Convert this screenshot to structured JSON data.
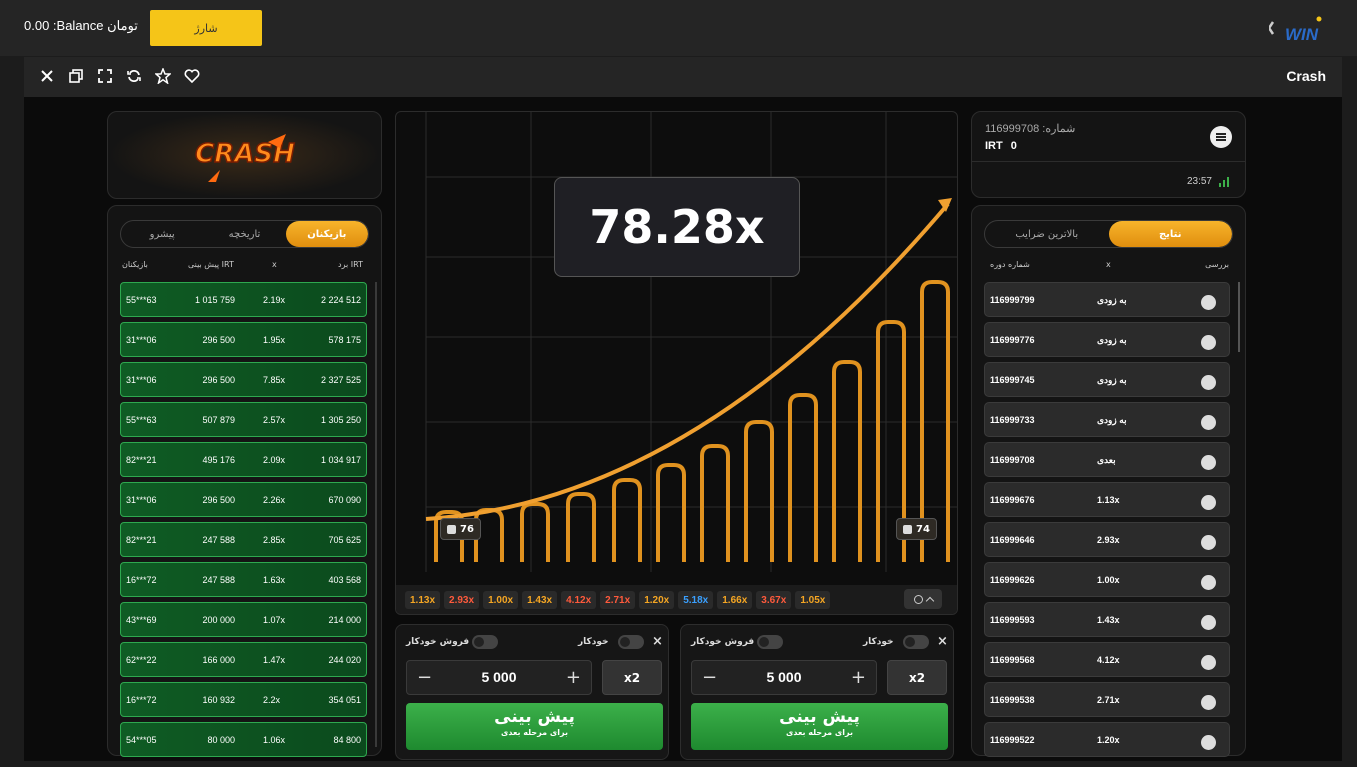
{
  "topbar": {
    "balance": "0.00 :Balance تومان",
    "charge_label": "شارژ",
    "logo_text": "WIN"
  },
  "frame": {
    "title": "Crash"
  },
  "logo_panel": {
    "text": "CRASH"
  },
  "players": {
    "tabs": [
      "پیشرو",
      "تاریخچه",
      "بازیکنان"
    ],
    "active_tab": 2,
    "headers": {
      "win": "برد IRT",
      "x": "x",
      "bet": "پیش بینی IRT",
      "player": "بازیکنان"
    },
    "rows": [
      {
        "player": "55***63",
        "bet": "1 015 759",
        "x": "2.19x",
        "win": "2 224 512"
      },
      {
        "player": "31***06",
        "bet": "296 500",
        "x": "1.95x",
        "win": "578 175"
      },
      {
        "player": "31***06",
        "bet": "296 500",
        "x": "7.85x",
        "win": "2 327 525"
      },
      {
        "player": "55***63",
        "bet": "507 879",
        "x": "2.57x",
        "win": "1 305 250"
      },
      {
        "player": "82***21",
        "bet": "495 176",
        "x": "2.09x",
        "win": "1 034 917"
      },
      {
        "player": "31***06",
        "bet": "296 500",
        "x": "2.26x",
        "win": "670 090"
      },
      {
        "player": "82***21",
        "bet": "247 588",
        "x": "2.85x",
        "win": "705 625"
      },
      {
        "player": "16***72",
        "bet": "247 588",
        "x": "1.63x",
        "win": "403 568"
      },
      {
        "player": "43***69",
        "bet": "200 000",
        "x": "1.07x",
        "win": "214 000"
      },
      {
        "player": "62***22",
        "bet": "166 000",
        "x": "1.47x",
        "win": "244 020"
      },
      {
        "player": "16***72",
        "bet": "160 932",
        "x": "2.2x",
        "win": "354 051"
      },
      {
        "player": "54***05",
        "bet": "80 000",
        "x": "1.06x",
        "win": "84 800"
      }
    ]
  },
  "game": {
    "multiplier": "78.28x",
    "left_badge": "76",
    "right_badge": "74",
    "history": [
      {
        "v": "1.13x",
        "c": "#f5a623"
      },
      {
        "v": "2.93x",
        "c": "#ff5a3c"
      },
      {
        "v": "1.00x",
        "c": "#f5a623"
      },
      {
        "v": "1.43x",
        "c": "#f5a623"
      },
      {
        "v": "4.12x",
        "c": "#ff5a3c"
      },
      {
        "v": "2.71x",
        "c": "#ff5a3c"
      },
      {
        "v": "1.20x",
        "c": "#f5a623"
      },
      {
        "v": "5.18x",
        "c": "#3aa0ff"
      },
      {
        "v": "1.66x",
        "c": "#f5a623"
      },
      {
        "v": "3.67x",
        "c": "#ff5a3c"
      },
      {
        "v": "1.05x",
        "c": "#f5a623"
      }
    ]
  },
  "bet_panels": [
    {
      "close": "×",
      "auto_label": "خودکار",
      "autosell_label": "فروش خودکار",
      "minus": "−",
      "amount": "5 000",
      "plus": "+",
      "double": "x2",
      "btn_title": "پیش بینی",
      "btn_sub": "برای مرحله بعدی"
    },
    {
      "close": "×",
      "auto_label": "خودکار",
      "autosell_label": "فروش خودکار",
      "minus": "−",
      "amount": "5 000",
      "plus": "+",
      "double": "x2",
      "btn_title": "پیش بینی",
      "btn_sub": "برای مرحله بعدی"
    }
  ],
  "round_info": {
    "round_number": "116999708 :شماره",
    "currency": "IRT",
    "balance": "0",
    "time": "23:57"
  },
  "results": {
    "tabs": [
      "بالاترین ضرایب",
      "نتایج"
    ],
    "active_tab": 1,
    "headers": {
      "check": "بررسی",
      "x": "x",
      "round": "شماره دوره"
    },
    "rows": [
      {
        "round": "116999799",
        "x": "به زودی"
      },
      {
        "round": "116999776",
        "x": "به زودی"
      },
      {
        "round": "116999745",
        "x": "به زودی"
      },
      {
        "round": "116999733",
        "x": "به زودی"
      },
      {
        "round": "116999708",
        "x": "بعدی"
      },
      {
        "round": "116999676",
        "x": "1.13x"
      },
      {
        "round": "116999646",
        "x": "2.93x"
      },
      {
        "round": "116999626",
        "x": "1.00x"
      },
      {
        "round": "116999593",
        "x": "1.43x"
      },
      {
        "round": "116999568",
        "x": "4.12x"
      },
      {
        "round": "116999538",
        "x": "2.71x"
      },
      {
        "round": "116999522",
        "x": "1.20x"
      }
    ]
  }
}
